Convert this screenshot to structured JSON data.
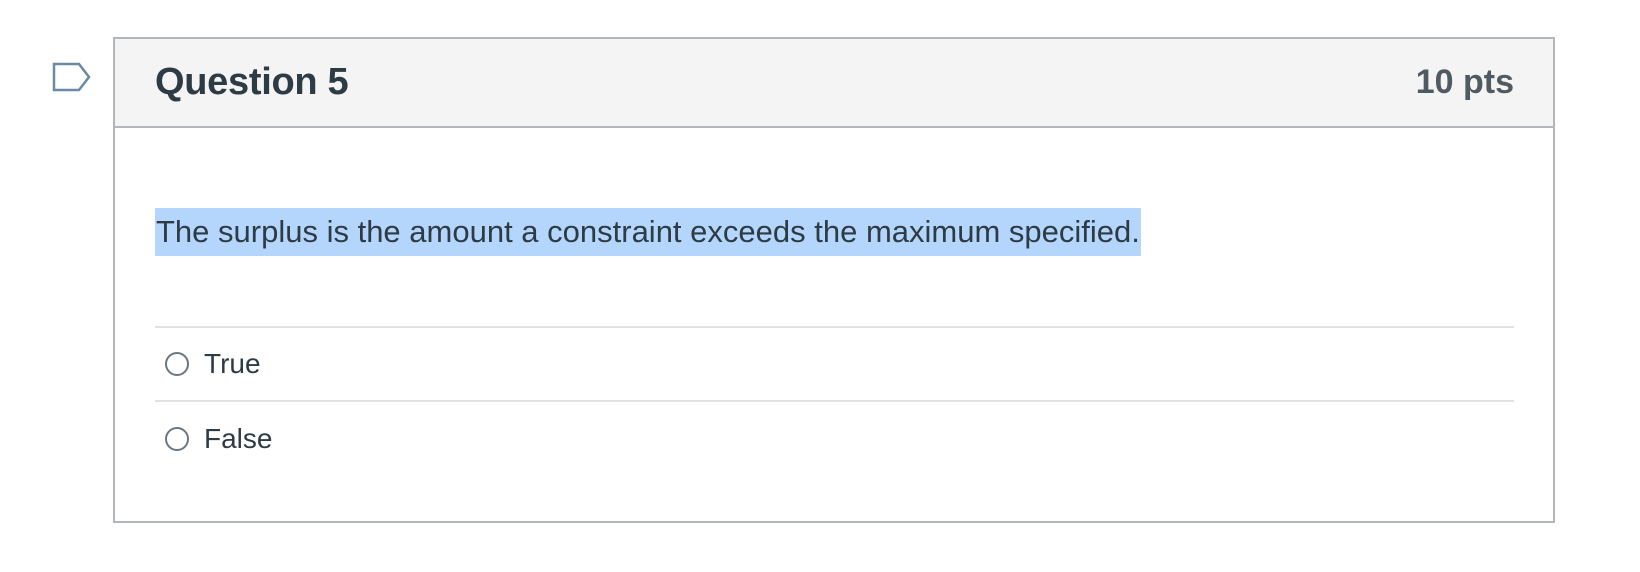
{
  "question": {
    "title": "Question 5",
    "points": "10 pts",
    "text": "The surplus is the amount a constraint exceeds the maximum specified.",
    "answers": [
      {
        "label": "True",
        "selected": false
      },
      {
        "label": "False",
        "selected": false
      }
    ]
  },
  "icons": {
    "flag": "flag-question-icon"
  },
  "colors": {
    "highlight": "#b5d6fc",
    "header_bg": "#f4f4f4",
    "text": "#2d3b45",
    "flag": "#6b8aa6"
  }
}
